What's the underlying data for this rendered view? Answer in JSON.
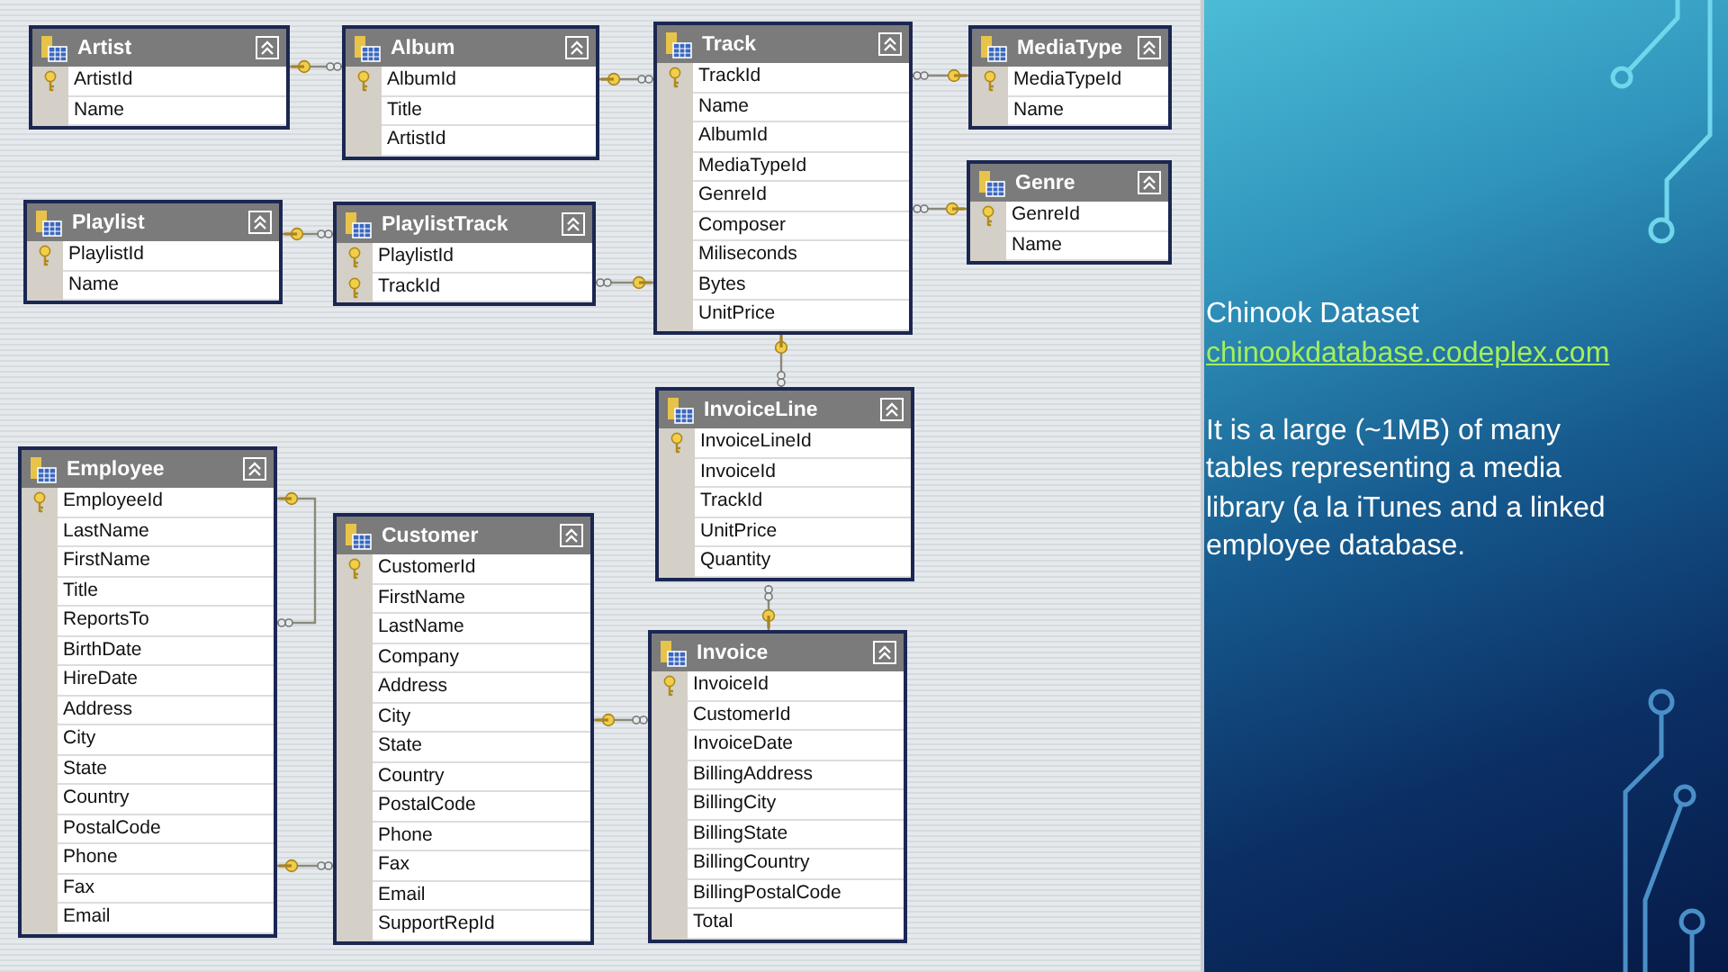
{
  "diagram": {
    "tables": [
      {
        "name": "Artist",
        "columns": [
          {
            "name": "ArtistId",
            "primary_key": true
          },
          {
            "name": "Name",
            "primary_key": false
          }
        ]
      },
      {
        "name": "Album",
        "columns": [
          {
            "name": "AlbumId",
            "primary_key": true
          },
          {
            "name": "Title",
            "primary_key": false
          },
          {
            "name": "ArtistId",
            "primary_key": false
          }
        ]
      },
      {
        "name": "Track",
        "columns": [
          {
            "name": "TrackId",
            "primary_key": true
          },
          {
            "name": "Name",
            "primary_key": false
          },
          {
            "name": "AlbumId",
            "primary_key": false
          },
          {
            "name": "MediaTypeId",
            "primary_key": false
          },
          {
            "name": "GenreId",
            "primary_key": false
          },
          {
            "name": "Composer",
            "primary_key": false
          },
          {
            "name": "Miliseconds",
            "primary_key": false
          },
          {
            "name": "Bytes",
            "primary_key": false
          },
          {
            "name": "UnitPrice",
            "primary_key": false
          }
        ]
      },
      {
        "name": "MediaType",
        "columns": [
          {
            "name": "MediaTypeId",
            "primary_key": true
          },
          {
            "name": "Name",
            "primary_key": false
          }
        ]
      },
      {
        "name": "Genre",
        "columns": [
          {
            "name": "GenreId",
            "primary_key": true
          },
          {
            "name": "Name",
            "primary_key": false
          }
        ]
      },
      {
        "name": "Playlist",
        "columns": [
          {
            "name": "PlaylistId",
            "primary_key": true
          },
          {
            "name": "Name",
            "primary_key": false
          }
        ]
      },
      {
        "name": "PlaylistTrack",
        "columns": [
          {
            "name": "PlaylistId",
            "primary_key": true
          },
          {
            "name": "TrackId",
            "primary_key": true
          }
        ]
      },
      {
        "name": "InvoiceLine",
        "columns": [
          {
            "name": "InvoiceLineId",
            "primary_key": true
          },
          {
            "name": "InvoiceId",
            "primary_key": false
          },
          {
            "name": "TrackId",
            "primary_key": false
          },
          {
            "name": "UnitPrice",
            "primary_key": false
          },
          {
            "name": "Quantity",
            "primary_key": false
          }
        ]
      },
      {
        "name": "Employee",
        "columns": [
          {
            "name": "EmployeeId",
            "primary_key": true
          },
          {
            "name": "LastName",
            "primary_key": false
          },
          {
            "name": "FirstName",
            "primary_key": false
          },
          {
            "name": "Title",
            "primary_key": false
          },
          {
            "name": "ReportsTo",
            "primary_key": false
          },
          {
            "name": "BirthDate",
            "primary_key": false
          },
          {
            "name": "HireDate",
            "primary_key": false
          },
          {
            "name": "Address",
            "primary_key": false
          },
          {
            "name": "City",
            "primary_key": false
          },
          {
            "name": "State",
            "primary_key": false
          },
          {
            "name": "Country",
            "primary_key": false
          },
          {
            "name": "PostalCode",
            "primary_key": false
          },
          {
            "name": "Phone",
            "primary_key": false
          },
          {
            "name": "Fax",
            "primary_key": false
          },
          {
            "name": "Email",
            "primary_key": false
          }
        ]
      },
      {
        "name": "Customer",
        "columns": [
          {
            "name": "CustomerId",
            "primary_key": true
          },
          {
            "name": "FirstName",
            "primary_key": false
          },
          {
            "name": "LastName",
            "primary_key": false
          },
          {
            "name": "Company",
            "primary_key": false
          },
          {
            "name": "Address",
            "primary_key": false
          },
          {
            "name": "City",
            "primary_key": false
          },
          {
            "name": "State",
            "primary_key": false
          },
          {
            "name": "Country",
            "primary_key": false
          },
          {
            "name": "PostalCode",
            "primary_key": false
          },
          {
            "name": "Phone",
            "primary_key": false
          },
          {
            "name": "Fax",
            "primary_key": false
          },
          {
            "name": "Email",
            "primary_key": false
          },
          {
            "name": "SupportRepId",
            "primary_key": false
          }
        ]
      },
      {
        "name": "Invoice",
        "columns": [
          {
            "name": "InvoiceId",
            "primary_key": true
          },
          {
            "name": "CustomerId",
            "primary_key": false
          },
          {
            "name": "InvoiceDate",
            "primary_key": false
          },
          {
            "name": "BillingAddress",
            "primary_key": false
          },
          {
            "name": "BillingCity",
            "primary_key": false
          },
          {
            "name": "BillingState",
            "primary_key": false
          },
          {
            "name": "BillingCountry",
            "primary_key": false
          },
          {
            "name": "BillingPostalCode",
            "primary_key": false
          },
          {
            "name": "Total",
            "primary_key": false
          }
        ]
      }
    ]
  },
  "panel": {
    "title": "Chinook Dataset",
    "link": "chinookdatabase.codeplex.com",
    "description": "It is a large (~1MB) of many tables representing a media library (a la iTunes and a linked employee database."
  }
}
